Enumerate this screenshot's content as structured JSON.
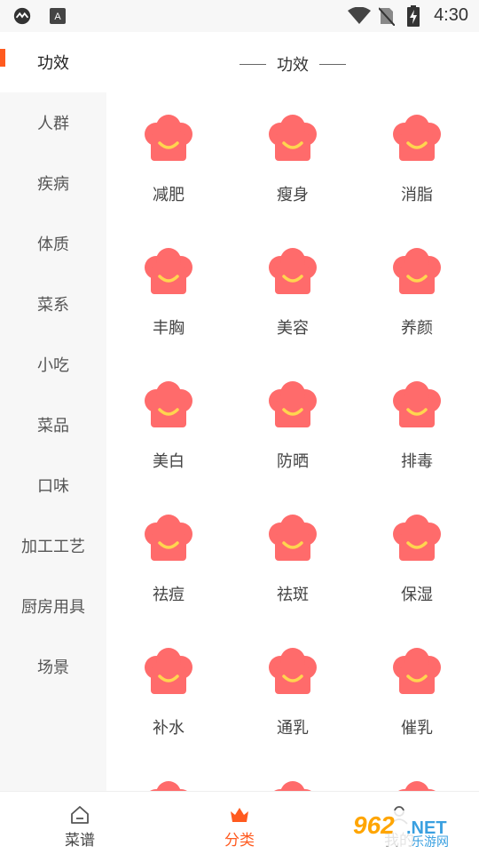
{
  "status_bar": {
    "time": "4:30"
  },
  "sidebar": {
    "items": [
      {
        "label": "功效",
        "active": true
      },
      {
        "label": "人群"
      },
      {
        "label": "疾病"
      },
      {
        "label": "体质"
      },
      {
        "label": "菜系"
      },
      {
        "label": "小吃"
      },
      {
        "label": "菜品"
      },
      {
        "label": "口味"
      },
      {
        "label": "加工工艺"
      },
      {
        "label": "厨房用具"
      },
      {
        "label": "场景"
      }
    ]
  },
  "content": {
    "section_title": "功效",
    "items": [
      {
        "label": "减肥"
      },
      {
        "label": "瘦身"
      },
      {
        "label": "消脂"
      },
      {
        "label": "丰胸"
      },
      {
        "label": "美容"
      },
      {
        "label": "养颜"
      },
      {
        "label": "美白"
      },
      {
        "label": "防晒"
      },
      {
        "label": "排毒"
      },
      {
        "label": "祛痘"
      },
      {
        "label": "祛斑"
      },
      {
        "label": "保湿"
      },
      {
        "label": "补水"
      },
      {
        "label": "通乳"
      },
      {
        "label": "催乳"
      }
    ]
  },
  "bottom_nav": {
    "items": [
      {
        "label": "菜谱",
        "icon": "home-icon"
      },
      {
        "label": "分类",
        "icon": "crown-icon",
        "active": true
      },
      {
        "label": "我的",
        "icon": "user-icon"
      }
    ]
  },
  "colors": {
    "accent": "#ff5a1f",
    "chef_icon": "#ff6b6b",
    "chef_smile": "#ffd54f"
  },
  "watermark": {
    "brand": "962",
    "suffix": ".NET",
    "site": "乐游网"
  }
}
